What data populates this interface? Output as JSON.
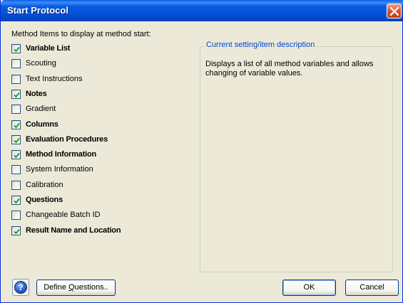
{
  "window": {
    "title": "Start Protocol"
  },
  "group_label": "Method Items to display at method start:",
  "items": [
    {
      "label": "Variable List",
      "checked": true
    },
    {
      "label": "Scouting",
      "checked": false
    },
    {
      "label": "Text Instructions",
      "checked": false
    },
    {
      "label": "Notes",
      "checked": true
    },
    {
      "label": "Gradient",
      "checked": false
    },
    {
      "label": "Columns",
      "checked": true
    },
    {
      "label": "Evaluation Procedures",
      "checked": true
    },
    {
      "label": "Method Information",
      "checked": true
    },
    {
      "label": "System Information",
      "checked": false
    },
    {
      "label": "Calibration",
      "checked": false
    },
    {
      "label": "Questions",
      "checked": true
    },
    {
      "label": "Changeable Batch ID",
      "checked": false
    },
    {
      "label": "Result Name and Location",
      "checked": true
    }
  ],
  "description": {
    "legend": "Current setting/item description",
    "text": "Displays a list of all method variables and allows changing of variable values."
  },
  "buttons": {
    "help": "?",
    "define_questions": "Define Questions..",
    "ok": "OK",
    "cancel": "Cancel"
  },
  "colors": {
    "titlebar": "#0554d9",
    "legend_text": "#0046d5",
    "checkmark": "#21a121",
    "dialog_bg": "#ece9d8"
  }
}
